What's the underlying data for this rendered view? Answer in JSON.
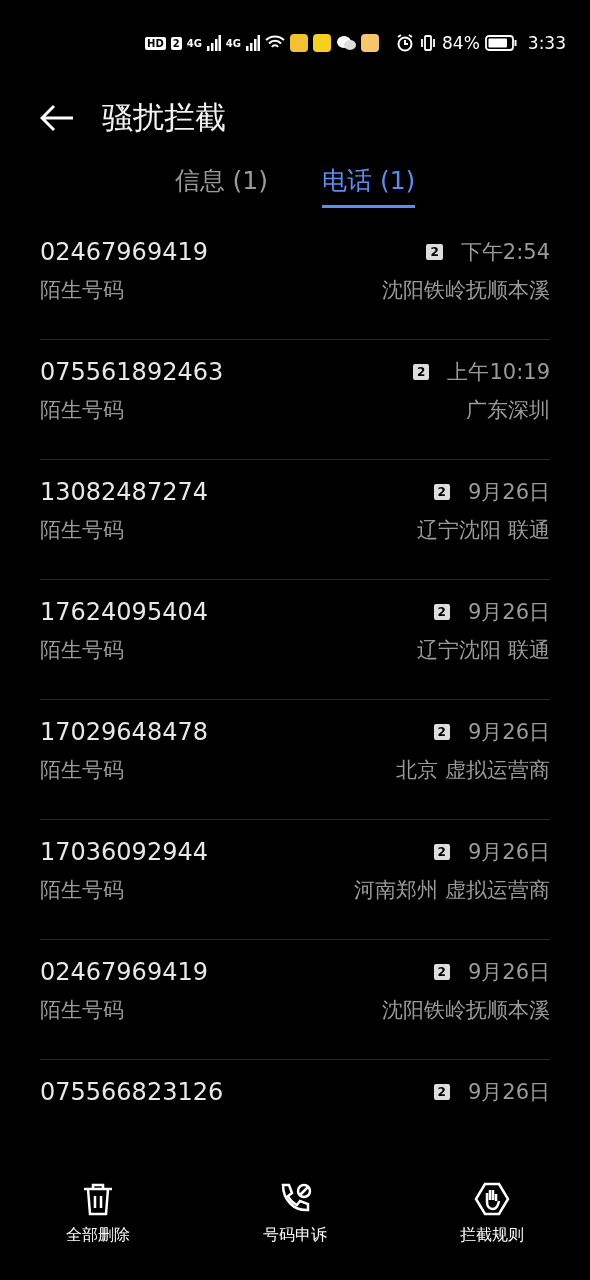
{
  "status_bar": {
    "hd": "HD",
    "sim": "2",
    "networks": [
      "4G",
      "4G"
    ],
    "battery": "84%",
    "time": "3:33"
  },
  "header": {
    "title": "骚扰拦截"
  },
  "tabs": [
    {
      "label": "信息 (1)",
      "selected": false
    },
    {
      "label": "电话 (1)",
      "selected": true
    }
  ],
  "calls": [
    {
      "number": "02467969419",
      "label": "陌生号码",
      "sim": "2",
      "time": "下午2:54",
      "location": "沈阳铁岭抚顺本溪"
    },
    {
      "number": "075561892463",
      "label": "陌生号码",
      "sim": "2",
      "time": "上午10:19",
      "location": "广东深圳"
    },
    {
      "number": "13082487274",
      "label": "陌生号码",
      "sim": "2",
      "time": "9月26日",
      "location": "辽宁沈阳 联通"
    },
    {
      "number": "17624095404",
      "label": "陌生号码",
      "sim": "2",
      "time": "9月26日",
      "location": "辽宁沈阳 联通"
    },
    {
      "number": "17029648478",
      "label": "陌生号码",
      "sim": "2",
      "time": "9月26日",
      "location": "北京 虚拟运营商"
    },
    {
      "number": "17036092944",
      "label": "陌生号码",
      "sim": "2",
      "time": "9月26日",
      "location": "河南郑州 虚拟运营商"
    },
    {
      "number": "02467969419",
      "label": "陌生号码",
      "sim": "2",
      "time": "9月26日",
      "location": "沈阳铁岭抚顺本溪"
    },
    {
      "number": "075566823126",
      "sim": "2",
      "time": "9月26日"
    }
  ],
  "bottom_bar": [
    {
      "kind": "delete",
      "label": "全部删除"
    },
    {
      "kind": "appeal",
      "label": "号码申诉"
    },
    {
      "kind": "rules",
      "label": "拦截规则"
    }
  ]
}
